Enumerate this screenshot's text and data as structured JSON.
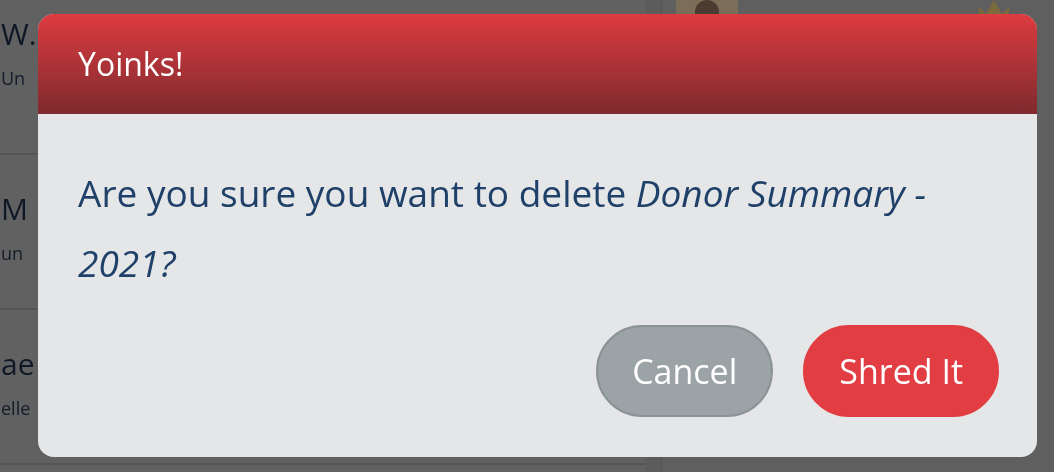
{
  "background": {
    "list_items": [
      {
        "title": "W.",
        "subtitle": "Un"
      },
      {
        "title": "M",
        "subtitle": "un"
      },
      {
        "title": "ae",
        "subtitle": "elle"
      }
    ]
  },
  "dialog": {
    "title": "Yoinks!",
    "message": "Are you sure you want to delete *Donor Summary - 2021?*",
    "buttons": [
      {
        "label": "Cancel",
        "kind": "secondary"
      },
      {
        "label": "Shred It",
        "kind": "danger"
      }
    ]
  }
}
